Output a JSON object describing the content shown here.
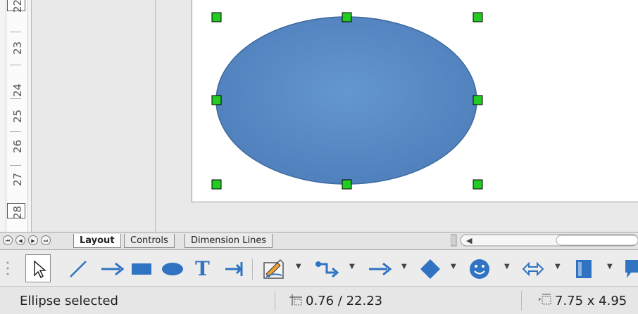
{
  "ruler": {
    "labels": [
      "22",
      "23",
      "24",
      "25",
      "26",
      "27",
      "28"
    ]
  },
  "canvas": {
    "shape": "ellipse",
    "fill_color": "#5b8cc5",
    "stroke_color": "#3d6a9f",
    "handle_color": "#22cc22"
  },
  "tabs": {
    "nav_icons": [
      "first-sheet-icon",
      "previous-sheet-icon",
      "next-sheet-icon",
      "last-sheet-icon"
    ],
    "items": [
      "Layout",
      "Controls",
      "Dimension Lines"
    ],
    "active": "Layout"
  },
  "toolbar": {
    "tools": [
      "select-tool",
      "line-tool",
      "arrow-tool",
      "rectangle-tool",
      "ellipse-tool",
      "text-tool",
      "dimension-line-tool",
      "curve-tool",
      "connector-tool",
      "lines-arrows-tool",
      "basic-shapes-tool",
      "symbol-shapes-tool",
      "block-arrows-tool",
      "flowchart-tool",
      "callouts-tool"
    ]
  },
  "status": {
    "message": "Ellipse selected",
    "position": "0.76 / 22.23",
    "size": "7.75 x 4.95"
  }
}
